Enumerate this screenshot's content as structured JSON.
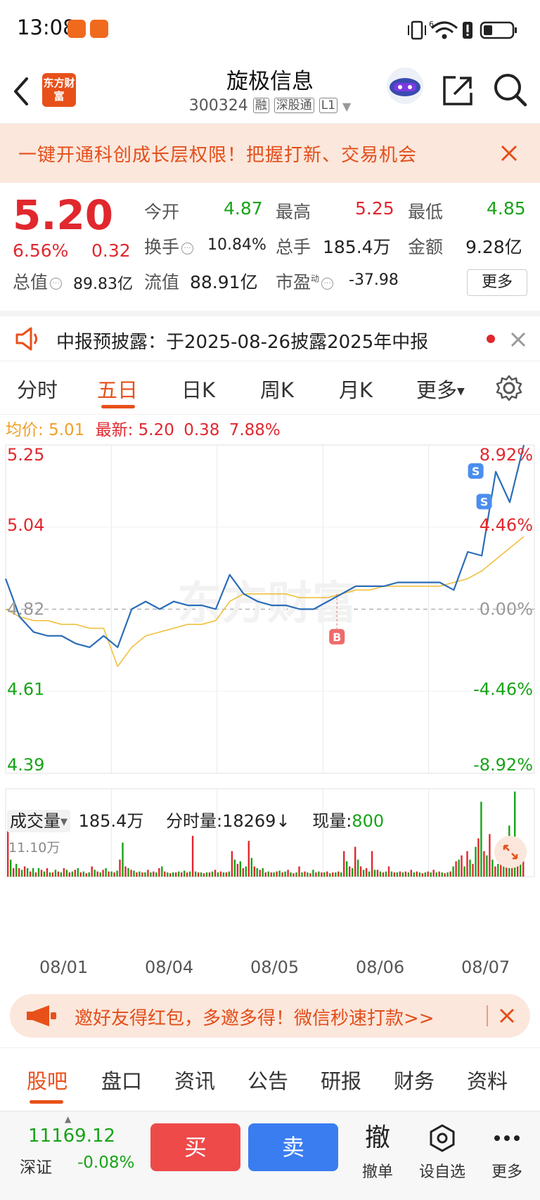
{
  "status_bar": {
    "time": "13:08",
    "network": "6"
  },
  "header": {
    "logo_text": "东方财富",
    "stock_name": "旋极信息",
    "stock_code": "300324",
    "tags": [
      "融",
      "深股通",
      "L1"
    ]
  },
  "banner": {
    "text": "一键开通科创成长层权限！把握打新、交易机会"
  },
  "quote": {
    "price": "5.20",
    "change_pct": "6.56%",
    "change": "0.32",
    "open_label": "今开",
    "open": "4.87",
    "high_label": "最高",
    "high": "5.25",
    "low_label": "最低",
    "low": "4.85",
    "turnover_label": "换手",
    "turnover": "10.84%",
    "volume_label": "总手",
    "volume": "185.4万",
    "amount_label": "金额",
    "amount": "9.28亿",
    "mktcap_label": "总值",
    "mktcap": "89.83亿",
    "float_label": "流值",
    "float": "88.91亿",
    "pe_label": "市盈",
    "pe_super": "动",
    "pe": "-37.98",
    "more": "更多"
  },
  "notice": {
    "text": "中报预披露：于2025-08-26披露2025年中报"
  },
  "tabs": {
    "items": [
      "分时",
      "五日",
      "日K",
      "周K",
      "月K",
      "更多"
    ],
    "active": 1
  },
  "infoline": {
    "avg_label": "均价:",
    "avg": "5.01",
    "latest_label": "最新:",
    "latest": "5.20",
    "chg": "0.38",
    "pct": "7.88%"
  },
  "chart_data": {
    "type": "line",
    "title": "",
    "y_left_ticks": [
      "5.25",
      "5.04",
      "4.82",
      "4.61",
      "4.39"
    ],
    "y_right_ticks": [
      "8.92%",
      "4.46%",
      "0.00%",
      "-4.46%",
      "-8.92%"
    ],
    "ylim": [
      4.39,
      5.25
    ],
    "prev_close": 4.82,
    "days": [
      "08/01",
      "08/04",
      "08/05",
      "08/06",
      "08/07"
    ],
    "series": [
      {
        "name": "",
        "color": "#2a6db8",
        "values": [
          4.9,
          4.8,
          4.76,
          4.75,
          4.75,
          4.73,
          4.72,
          4.75,
          4.72,
          4.82,
          4.84,
          4.82,
          4.84,
          4.83,
          4.83,
          4.82,
          4.91,
          4.86,
          4.84,
          4.83,
          4.83,
          4.82,
          4.82,
          4.84,
          4.86,
          4.88,
          4.88,
          4.88,
          4.89,
          4.89,
          4.89,
          4.89,
          4.87,
          4.97,
          4.96,
          5.18,
          5.1,
          5.25
        ]
      },
      {
        "name": "",
        "color": "#f0c040",
        "values": [
          4.82,
          4.8,
          4.79,
          4.79,
          4.78,
          4.78,
          4.77,
          4.77,
          4.67,
          4.72,
          4.75,
          4.76,
          4.77,
          4.78,
          4.78,
          4.79,
          4.84,
          4.86,
          4.86,
          4.86,
          4.86,
          4.85,
          4.85,
          4.85,
          4.86,
          4.87,
          4.87,
          4.88,
          4.88,
          4.88,
          4.88,
          4.88,
          4.89,
          4.9,
          4.92,
          4.95,
          4.98,
          5.01
        ]
      }
    ],
    "markers": [
      {
        "label": "B",
        "day": 3,
        "price": 4.86,
        "color": "#f06a6a"
      },
      {
        "label": "S",
        "day": 4,
        "price": 5.18,
        "color": "#4a8ef0"
      },
      {
        "label": "S",
        "day": 4,
        "price": 5.1,
        "color": "#4a8ef0"
      }
    ],
    "grid": true,
    "watermark": "东方财富"
  },
  "volume": {
    "label": "成交量",
    "total": "185.4万",
    "fs_label": "分时量:",
    "fs_value": "18269",
    "arrow": "↓",
    "cur_label": "现量:",
    "cur_value": "800",
    "max_label": "11.10万",
    "bars": [
      0.65,
      0.2,
      0.1,
      0.15,
      0.1,
      0.08,
      0.12,
      0.1,
      0.06,
      0.1,
      0.05,
      0.1,
      0.08,
      0.06,
      0.1,
      0.05,
      0.05,
      0.08,
      0.06,
      0.05,
      0.1,
      0.08,
      0.05,
      0.06,
      0.08,
      0.1,
      0.05,
      0.06,
      0.04,
      0.05,
      0.12,
      0.08,
      0.06,
      0.05,
      0.08,
      0.1,
      0.06,
      0.06,
      0.05,
      0.07,
      0.2,
      0.4,
      0.12,
      0.1,
      0.08,
      0.07,
      0.05,
      0.06,
      0.05,
      0.05,
      0.08,
      0.05,
      0.06,
      0.05,
      0.1,
      0.12,
      0.06,
      0.05,
      0.04,
      0.05,
      0.05,
      0.06,
      0.05,
      0.07,
      0.05,
      0.06,
      0.48,
      0.06,
      0.05,
      0.05,
      0.04,
      0.05,
      0.05,
      0.06,
      0.08,
      0.05,
      0.06,
      0.05,
      0.05,
      0.06,
      0.3,
      0.2,
      0.15,
      0.18,
      0.1,
      0.12,
      0.42,
      0.22,
      0.12,
      0.1,
      0.08,
      0.1,
      0.05,
      0.06,
      0.05,
      0.05,
      0.06,
      0.07,
      0.05,
      0.06,
      0.08,
      0.05,
      0.04,
      0.05,
      0.12,
      0.05,
      0.06,
      0.05,
      0.04,
      0.08,
      0.05,
      0.06,
      0.05,
      0.05,
      0.06,
      0.04,
      0.05,
      0.05,
      0.06,
      0.05,
      0.3,
      0.18,
      0.12,
      0.1,
      0.35,
      0.2,
      0.12,
      0.08,
      0.1,
      0.06,
      0.3,
      0.08,
      0.08,
      0.06,
      0.05,
      0.06,
      0.12,
      0.06,
      0.05,
      0.05,
      0.06,
      0.05,
      0.06,
      0.05,
      0.08,
      0.05,
      0.06,
      0.05,
      0.04,
      0.05,
      0.06,
      0.05,
      0.08,
      0.05,
      0.06,
      0.05,
      0.04,
      0.05,
      0.06,
      0.12,
      0.18,
      0.2,
      0.25,
      0.12,
      0.3,
      0.2,
      0.15,
      0.35,
      0.45,
      0.88,
      0.3,
      0.25,
      0.5,
      0.2,
      0.12,
      0.15,
      0.3,
      0.2,
      0.25,
      0.6,
      0.35,
      1.0,
      0.4,
      0.3,
      0.2
    ],
    "bar_colors": [
      "#e0282e",
      "#18a318"
    ]
  },
  "promo": {
    "text": "邀好友得红包，多邀多得！微信秒速打款>>"
  },
  "bottom_tabs": {
    "items": [
      "股吧",
      "盘口",
      "资讯",
      "公告",
      "研报",
      "财务",
      "资料"
    ],
    "active": 0
  },
  "footer": {
    "index_value": "11169.12",
    "index_name": "深证",
    "index_change": "-0.08%",
    "buy": "买",
    "sell": "卖",
    "cancel_icon": "撤",
    "cancel_label": "撤单",
    "watch_label": "设自选",
    "more_label": "更多"
  },
  "colors": {
    "up": "#e0282e",
    "down": "#18a318",
    "brand": "#e8501a",
    "price_line": "#2a6db8",
    "avg_line": "#f0c040"
  }
}
